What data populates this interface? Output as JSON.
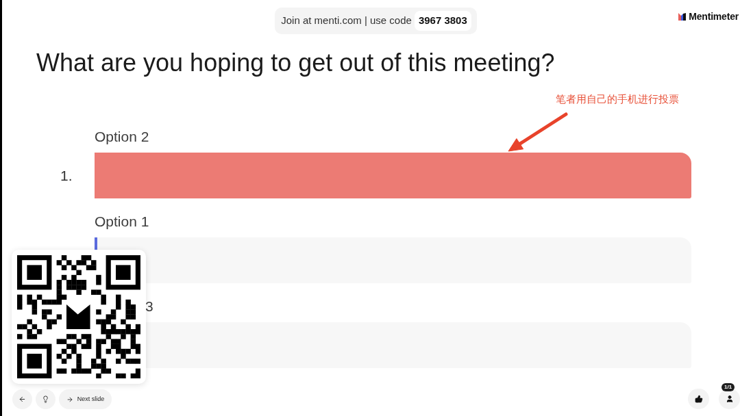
{
  "join_banner": {
    "text": "Join at menti.com | use code",
    "code": "3967 3803"
  },
  "logo": {
    "text": "Mentimeter"
  },
  "question": "What are you hoping to get out of this meeting?",
  "annotation": {
    "text": "笔者用自己的手机进行投票"
  },
  "options": [
    {
      "label": "Option 2",
      "rank": "1.",
      "level": 1,
      "color": "#ec7b74"
    },
    {
      "label": "Option 1",
      "level": 0.005,
      "color": "#5b6bde"
    },
    {
      "label": "3"
    }
  ],
  "navigation": [
    {
      "kind": "back"
    },
    {
      "kind": "tip"
    },
    {
      "kind": "next",
      "label": "Next slide"
    }
  ],
  "audience": [
    {
      "kind": "reactions"
    },
    {
      "kind": "participants",
      "badge": "1/1"
    }
  ]
}
